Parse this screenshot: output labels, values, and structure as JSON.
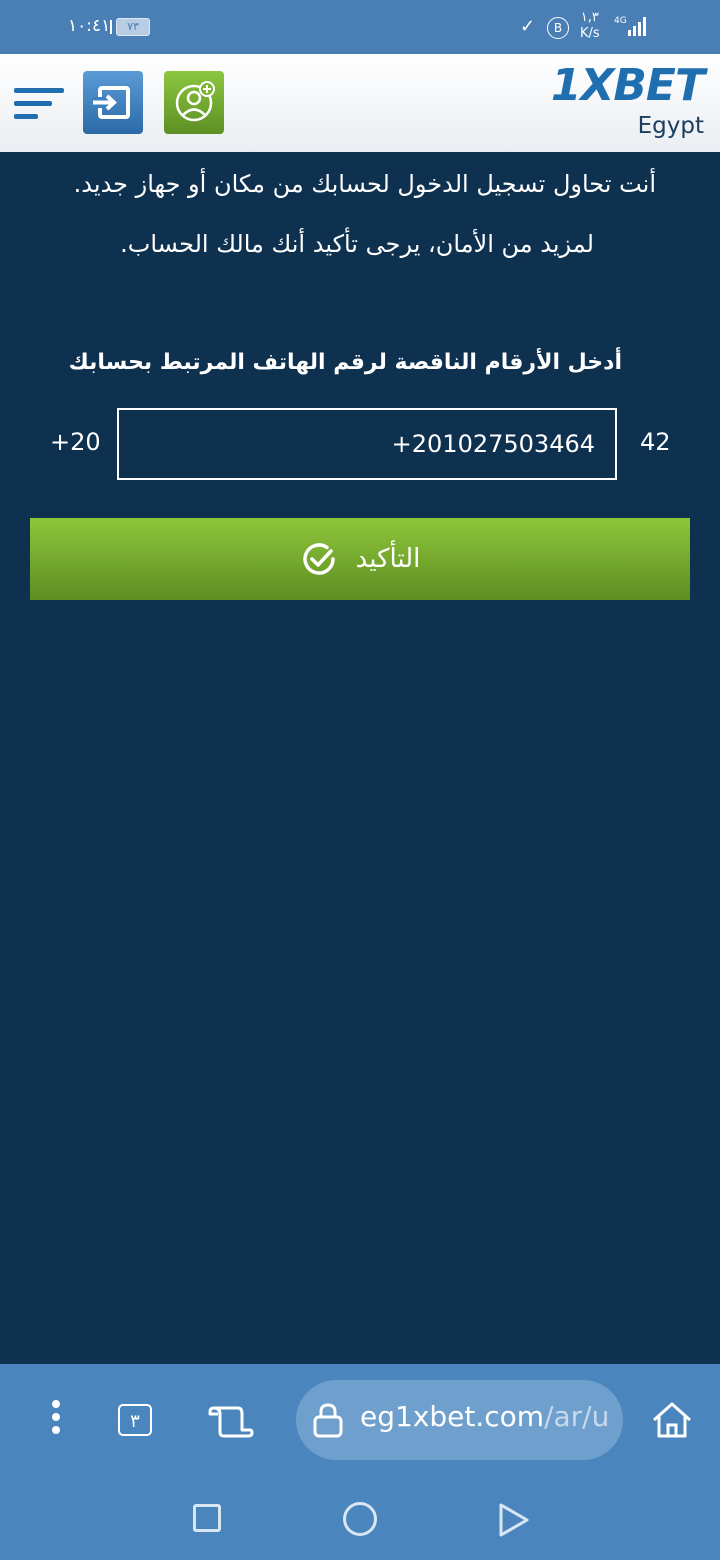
{
  "status_bar": {
    "time": "١٠:٤١",
    "battery": "٧٣",
    "speed_value": "١,٣",
    "speed_unit": "K/s",
    "network": "4G"
  },
  "header": {
    "logo": "1XBET",
    "region": "Egypt"
  },
  "main": {
    "notice_line1": "أنت تحاول تسجيل الدخول لحسابك من مكان أو جهاز جديد.",
    "notice_line2": "لمزيد من الأمان، يرجى تأكيد أنك مالك الحساب.",
    "prompt": "أدخل الأرقام الناقصة لرقم الهاتف المرتبط بحسابك",
    "country_code": "+20",
    "phone_value": "+201027503464",
    "phone_suffix": "42",
    "confirm_label": "التأكيد"
  },
  "browser": {
    "tab_count": "٣",
    "url_domain": "eg1xbet.com",
    "url_path": "/ar/u"
  },
  "colors": {
    "background": "#0f3150",
    "brand_blue": "#1f6fb0",
    "green": "#8cc63f"
  }
}
